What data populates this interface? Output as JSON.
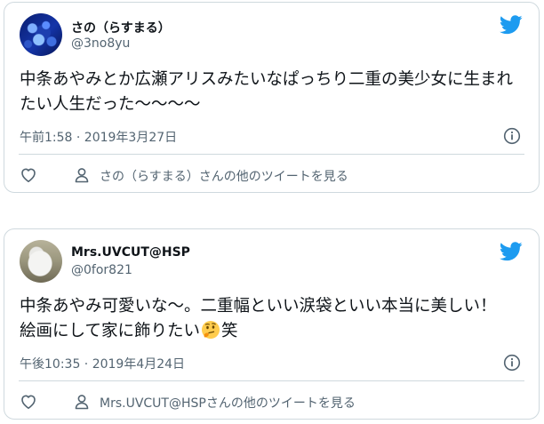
{
  "tweets": [
    {
      "display_name": "さの（らすまる）",
      "handle": "@3no8yu",
      "text": "中条あやみとか広瀬アリスみたいなぱっちり二重の美少女に生まれたい人生だった〜〜〜〜",
      "text_after_emoji": "",
      "timestamp": "午前1:58 · 2019年3月27日",
      "more_link": "さの（らすまる）さんの他のツイートを見る",
      "avatar_icon": "avatar-blue-lights",
      "brand_color": "#1d9bf0"
    },
    {
      "display_name": "Mrs.UVCUT@HSP",
      "handle": "@0for821",
      "text": "中条あやみ可愛いな〜。二重幅といい涙袋といい本当に美しい！\n絵画にして家に飾りたい",
      "text_after_emoji": "笑",
      "timestamp": "午後10:35 · 2019年4月24日",
      "more_link": "Mrs.UVCUT@HSPさんの他のツイートを見る",
      "avatar_icon": "avatar-white-duck",
      "brand_color": "#1d9bf0"
    }
  ]
}
